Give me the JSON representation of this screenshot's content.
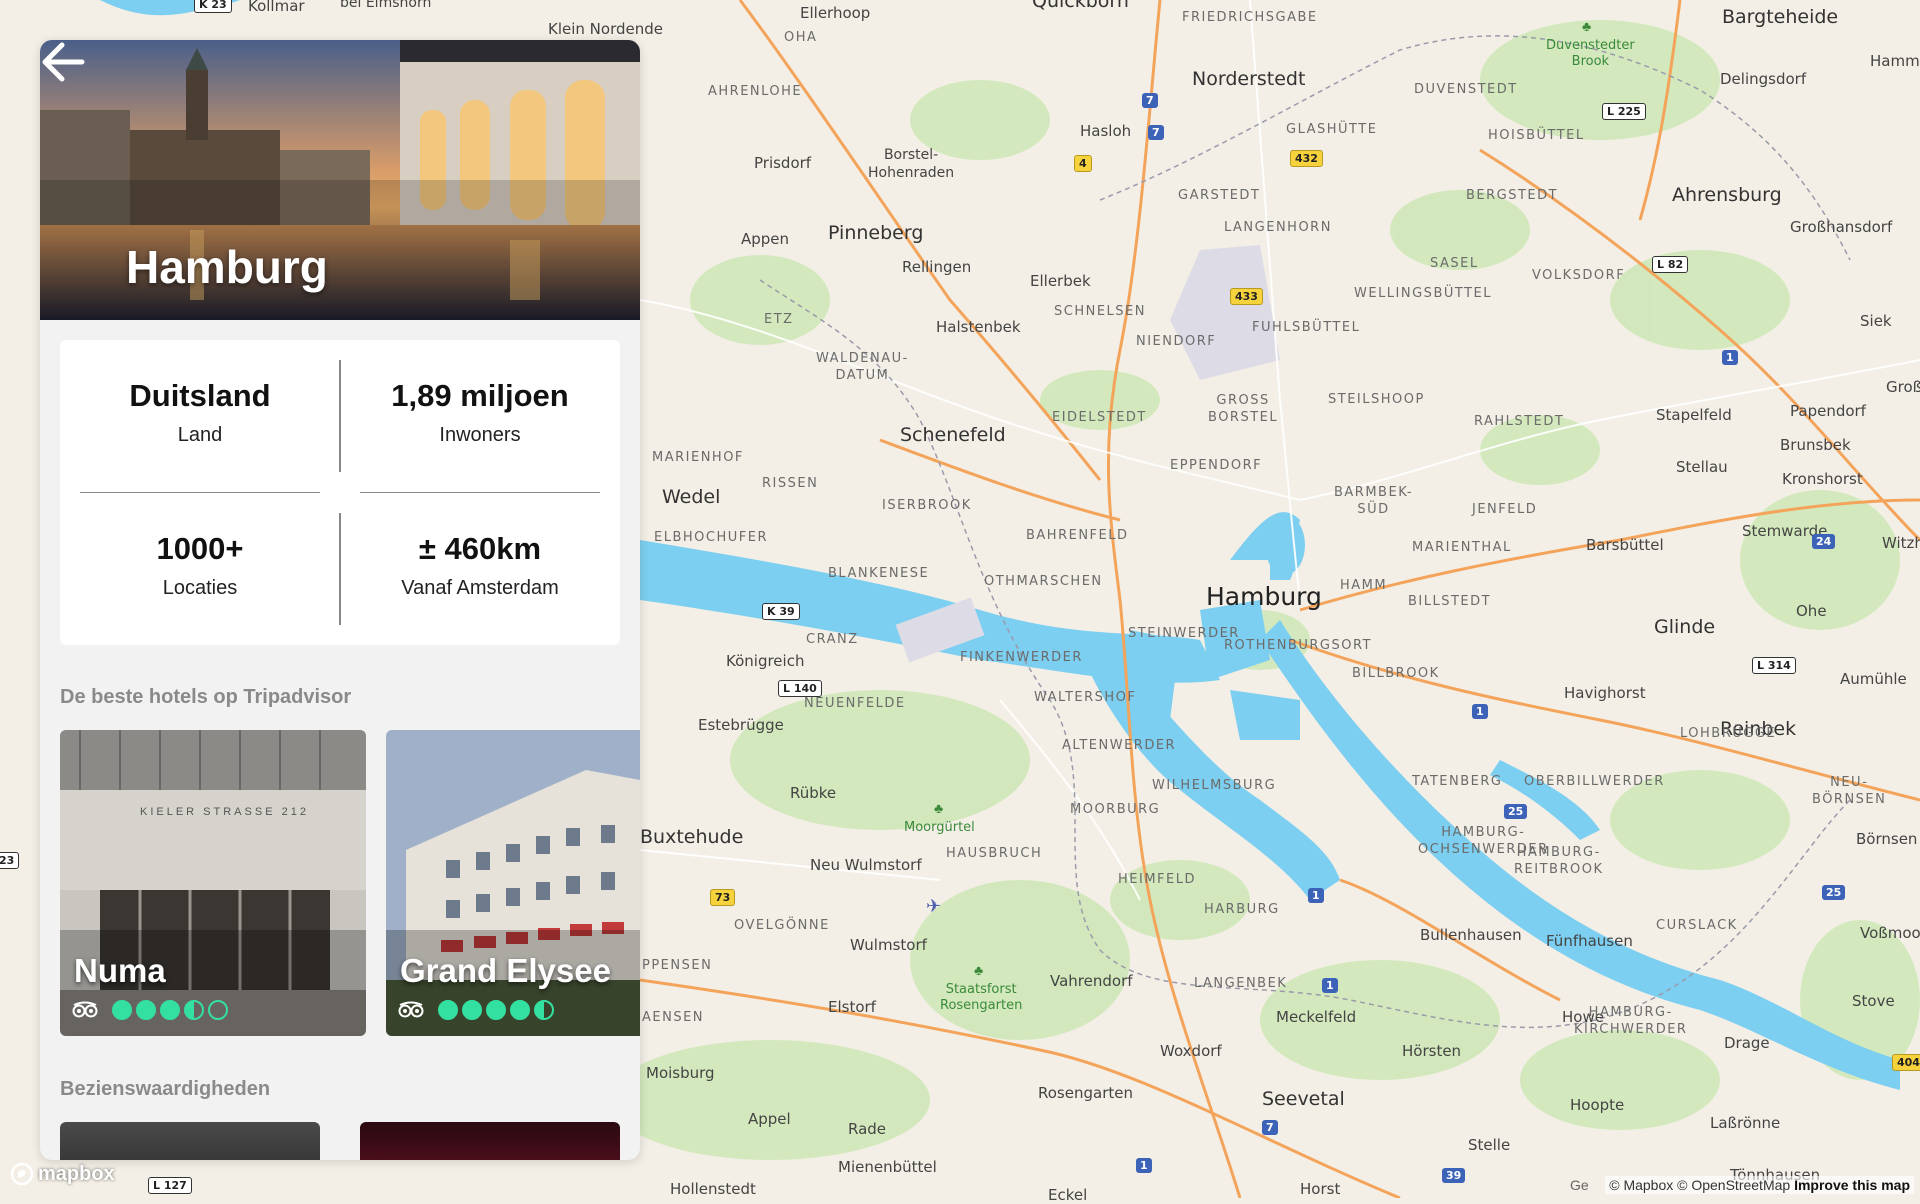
{
  "map": {
    "center_label": "Hamburg",
    "labels": {
      "towns": [
        "Kollmar",
        "bei Elmshorn",
        "Klein Nordende",
        "Ellerhoop",
        "Quickborn",
        "Bargteheide",
        "Hammoor",
        "Delingsdorf",
        "Norderstedt",
        "Hasloh",
        "Appen",
        "Prisdorf",
        "Borstel-\nHohenraden",
        "Pinneberg",
        "Rellingen",
        "Ellerbek",
        "Halstenbek",
        "Ahrensburg",
        "Großhansdorf",
        "Siek",
        "Papendorf",
        "Brunsbek",
        "Stapelfeld",
        "Stellau",
        "Kronshorst",
        "Schenefeld",
        "Wedel",
        "Stemwarde",
        "Barsbüttel",
        "Ohe",
        "Glinde",
        "Aumühle",
        "Havighorst",
        "Reinbek",
        "Königreich",
        "Estebrügge",
        "Rübke",
        "Buxtehude",
        "Neu Wulmstorf",
        "Wulmstorf",
        "Vahrendorf",
        "Elstorf",
        "Meckelfeld",
        "Woxdorf",
        "Hörsten",
        "Bullenhausen",
        "Fünfhausen",
        "Howe",
        "Drage",
        "Börnsen",
        "Voßmoor",
        "Stove",
        "Rosengarten",
        "Seevetal",
        "Appel",
        "Rade",
        "Hoopte",
        "Laßrönne",
        "Stelle",
        "Mienenbüttel",
        "Hollenstedt",
        "Eckel",
        "Horst",
        "Tönnhausen",
        "Moisburg",
        "Witzh",
        "Großh"
      ],
      "districts": [
        "OHA",
        "AHRENLOHE",
        "FRIEDRICHSGABE",
        "DUVENSTEDT",
        "HOISBÜTTEL",
        "GLASHÜTTE",
        "GARSTEDT",
        "LANGENHORN",
        "BERGSTEDT",
        "SASEL",
        "VOLKSDORF",
        "WELLINGSBÜTTEL",
        "SCHNELSEN",
        "NIENDORF",
        "FUHLSBÜTTEL",
        "ETZ",
        "WALDENAU-\nDATUM",
        "EIDELSTEDT",
        "GROSS\nBORSTEL",
        "STEILSHOOP",
        "RAHLSTEDT",
        "EPPENDORF",
        "MARIENHOF",
        "RISSEN",
        "ISERBROOK",
        "BAHRENFELD",
        "BARMBEK-\nSÜD",
        "JENFELD",
        "MARIENTHAL",
        "ELBHOCHUFER",
        "BLANKENESE",
        "OTHMARSCHEN",
        "HAMM",
        "BILLSTEDT",
        "STEINWERDER",
        "ROTHENBURGSORT",
        "CRANZ",
        "FINKENWERDER",
        "BILLBROOK",
        "NEUENFELDE",
        "WALTERSHOF",
        "LOHBRÜGGE",
        "ALTENWERDER",
        "TATENBERG",
        "OBERBILLWERDER",
        "NEU-\nBÖRNSEN",
        "WILHELMSBURG",
        "MOORBURG",
        "HAMBURG-\nOCHSENWERDER",
        "HAMBURG-\nREITBROOK",
        "HAUSBRUCH",
        "HEIMFELD",
        "OVELGÖNNE",
        "HARBURG",
        "CURSLACK",
        "PPENSEN",
        "LANGENBEK",
        "HAMBURG-\nKIRCHWERDER",
        "AENSEN"
      ],
      "parks": [
        "Duvenstedter\nBrook",
        "Moorgürtel",
        "Staatsforst\nRosengarten"
      ],
      "shields": [
        "7",
        "7",
        "4",
        "432",
        "433",
        "L 225",
        "L 82",
        "1",
        "24",
        "K 39",
        "L 140",
        "L 314",
        "1",
        "25",
        "73",
        "1",
        "1",
        "25",
        "7",
        "1",
        "39",
        "L 127",
        "404",
        "K 23",
        "23"
      ]
    }
  },
  "panel": {
    "city": "Hamburg",
    "stats": [
      {
        "value": "Duitsland",
        "label": "Land"
      },
      {
        "value": "1,89 miljoen",
        "label": "Inwoners"
      },
      {
        "value": "1000+",
        "label": "Locaties"
      },
      {
        "value": "± 460km",
        "label": "Vanaf Amsterdam"
      }
    ],
    "hotels_title": "De beste hotels op Tripadvisor",
    "hotels": [
      {
        "name": "Numa",
        "rating": 3.5,
        "image_sign": "KIELER STRASSE 212"
      },
      {
        "name": "Grand Elysee",
        "rating": 4.5
      }
    ],
    "sights_title": "Bezienswaardigheden"
  },
  "footer": {
    "logo": "mapbox",
    "attribution": "© Mapbox © OpenStreetMap",
    "improve": "Improve this map",
    "attrib_prefix": "Ge"
  },
  "colors": {
    "water": "#7ccff0",
    "land": "#f3efe6",
    "park": "#cfe8b8",
    "motorway": "#f4a45a",
    "tripadvisor": "#34e0a1"
  }
}
